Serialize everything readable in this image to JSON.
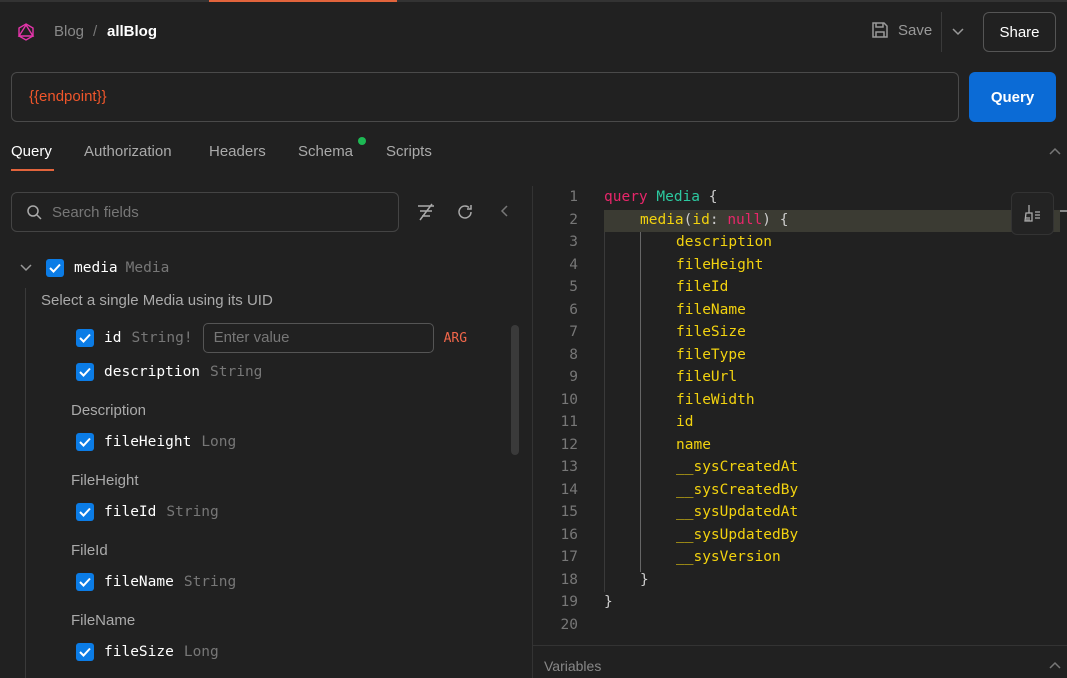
{
  "header": {
    "breadcrumb_parent": "Blog",
    "breadcrumb_separator": "/",
    "title": "allBlog",
    "save_label": "Save",
    "share_label": "Share"
  },
  "endpoint": {
    "value": "{{endpoint}}",
    "query_label": "Query"
  },
  "tabs": [
    {
      "label": "Query",
      "active": true
    },
    {
      "label": "Authorization"
    },
    {
      "label": "Headers"
    },
    {
      "label": "Schema",
      "status_dot": "#1db954"
    },
    {
      "label": "Scripts"
    }
  ],
  "explorer": {
    "search_placeholder": "Search fields",
    "root": {
      "name": "media",
      "type": "Media",
      "description": "Select a single Media using its UID",
      "checked": true
    },
    "arg": {
      "name": "id",
      "type": "String!",
      "placeholder": "Enter value",
      "badge": "ARG",
      "checked": true
    },
    "fields": [
      {
        "name": "description",
        "type": "String",
        "description": "Description",
        "checked": true
      },
      {
        "name": "fileHeight",
        "type": "Long",
        "description": "FileHeight",
        "checked": true
      },
      {
        "name": "fileId",
        "type": "String",
        "description": "FileId",
        "checked": true
      },
      {
        "name": "fileName",
        "type": "String",
        "description": "FileName",
        "checked": true
      },
      {
        "name": "fileSize",
        "type": "Long",
        "checked": true
      }
    ]
  },
  "editor": {
    "line_numbers": [
      "1",
      "2",
      "3",
      "4",
      "5",
      "6",
      "7",
      "8",
      "9",
      "10",
      "11",
      "12",
      "13",
      "14",
      "15",
      "16",
      "17",
      "18",
      "19",
      "20"
    ],
    "keyword": "query",
    "op_name": "Media",
    "root_field": "media",
    "arg_name": "id",
    "arg_value": "null",
    "fields": [
      "description",
      "fileHeight",
      "fileId",
      "fileName",
      "fileSize",
      "fileType",
      "fileUrl",
      "fileWidth",
      "id",
      "name",
      "__sysCreatedAt",
      "__sysCreatedBy",
      "__sysUpdatedAt",
      "__sysUpdatedBy",
      "__sysVersion"
    ]
  },
  "variables_label": "Variables",
  "colors": {
    "accent": "#e2643c",
    "primary": "#0b6bd6",
    "endpoint": "#f0562b"
  }
}
